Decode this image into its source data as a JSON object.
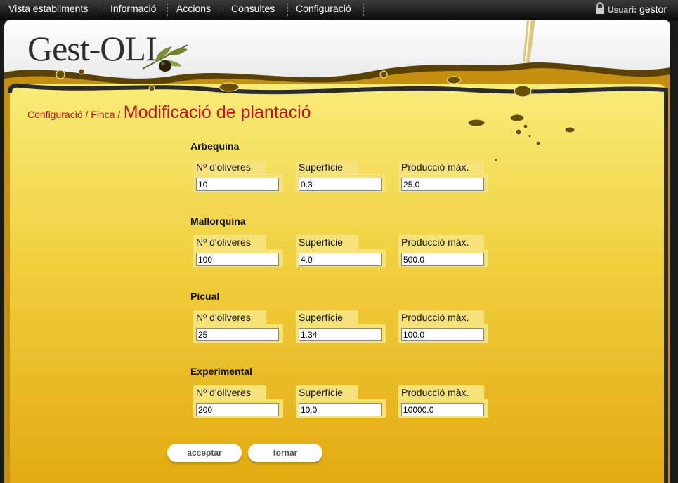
{
  "menu": {
    "items": [
      "Vista establiments",
      "Informació",
      "Accions",
      "Consultes",
      "Configuració"
    ],
    "user_label": "Usuari:",
    "user_name": "gestor",
    "user_icon": "lock-icon"
  },
  "logo": {
    "text": "Gest-OLI",
    "icon": "olive-branch-icon"
  },
  "breadcrumb": {
    "path": "Configuració / Finca /",
    "title": "Modificació de plantació"
  },
  "form": {
    "labels": {
      "olives": "Nº d'oliveres",
      "surface": "Superfície",
      "production": "Producció màx."
    },
    "varieties": [
      {
        "name": "Arbequina",
        "olives": "10",
        "surface": "0.3",
        "production": "25.0"
      },
      {
        "name": "Mallorquina",
        "olives": "100",
        "surface": "4.0",
        "production": "500.0"
      },
      {
        "name": "Picual",
        "olives": "25",
        "surface": "1.34",
        "production": "100.0"
      },
      {
        "name": "Experimental",
        "olives": "200",
        "surface": "10.0",
        "production": "10000.0"
      }
    ]
  },
  "buttons": {
    "accept": "acceptar",
    "back": "tornar"
  },
  "colors": {
    "oil_light": "#f7e76a",
    "oil_dark": "#e3aa12",
    "title_red": "#c0141c",
    "field_bg": "#f5e27a"
  }
}
